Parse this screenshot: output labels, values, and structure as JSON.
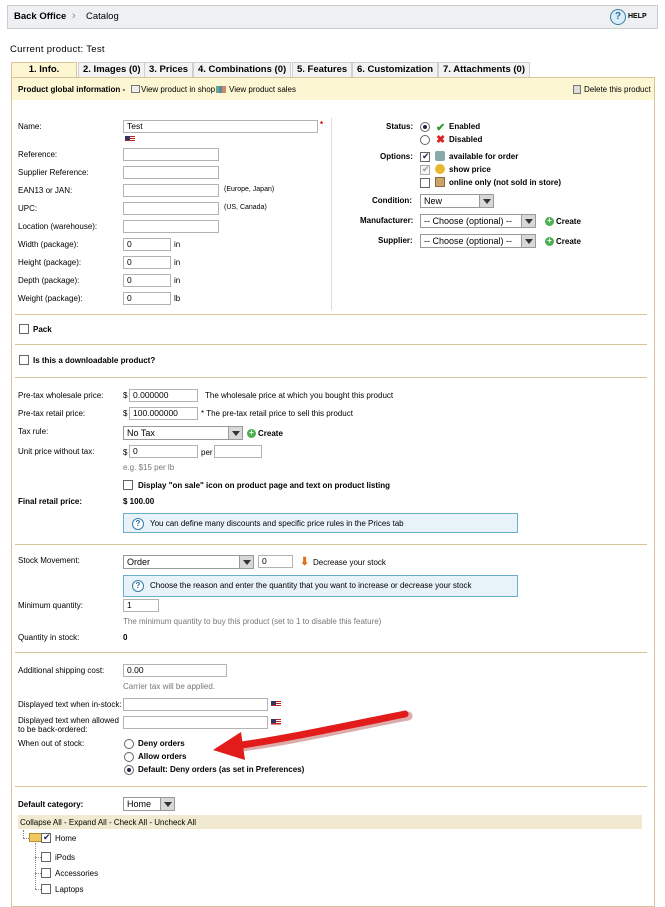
{
  "breadcrumb": {
    "root": "Back Office",
    "sep": "›",
    "current": "Catalog",
    "help": "HELP"
  },
  "current_product": "Current product: Test",
  "tabs": [
    "1. Info.",
    "2. Images (0)",
    "3. Prices",
    "4. Combinations (0)",
    "5. Features",
    "6. Customization",
    "7. Attachments (0)"
  ],
  "header": {
    "title": "Product global information -",
    "view_shop": "View product in shop -",
    "view_sales": "View product sales",
    "delete": "Delete this product"
  },
  "fields": {
    "name_label": "Name:",
    "name_value": "Test",
    "required": "*",
    "reference": "Reference:",
    "supplier_reference": "Supplier Reference:",
    "ean": "EAN13 or JAN:",
    "ean_hint": "(Europe, Japan)",
    "upc": "UPC:",
    "upc_hint": "(US, Canada)",
    "location": "Location (warehouse):",
    "width": "Width (package):",
    "height": "Height (package):",
    "depth": "Depth (package):",
    "weight": "Weight (package):",
    "zero": "0",
    "unit_in": "in",
    "unit_lb": "lb"
  },
  "right": {
    "status": "Status:",
    "enabled": "Enabled",
    "disabled": "Disabled",
    "options": "Options:",
    "available": "available for order",
    "show_price": "show price",
    "online_only": "online only (not sold in store)",
    "condition": "Condition:",
    "condition_value": "New",
    "manufacturer": "Manufacturer:",
    "supplier": "Supplier:",
    "choose": "-- Choose (optional) --",
    "create": "Create"
  },
  "pack": "Pack",
  "downloadable": "Is this a downloadable product?",
  "prices": {
    "wholesale": "Pre-tax wholesale price:",
    "currency": "$",
    "wholesale_value": "0.000000",
    "wholesale_hint": "The wholesale price at which you bought this product",
    "retail": "Pre-tax retail price:",
    "retail_value": "100.000000",
    "retail_hint": "* The pre-tax retail price to sell this product",
    "tax_rule": "Tax rule:",
    "tax_value": "No Tax",
    "create": "Create",
    "unit_price": "Unit price without tax:",
    "unit_value": "0",
    "per": "per",
    "unit_hint": "e.g. $15 per lb",
    "on_sale": "Display \"on sale\" icon on product page and text on product listing",
    "final": "Final retail price:",
    "final_value": "$ 100.00",
    "info": "You can define many discounts and specific price rules in the Prices tab"
  },
  "stock": {
    "movement": "Stock Movement:",
    "movement_value": "Order",
    "qty": "0",
    "decrease": "Decrease your stock",
    "info": "Choose the reason and enter the quantity that you want to increase or decrease your stock",
    "min_qty": "Minimum quantity:",
    "min_value": "1",
    "min_hint": "The minimum quantity to buy this product (set to 1 to disable this feature)",
    "in_stock": "Quantity in stock:",
    "in_stock_value": "0"
  },
  "shipping": {
    "additional": "Additional shipping cost:",
    "additional_value": "0.00",
    "carrier_hint": "Carrier tax will be applied.",
    "in_stock_text": "Displayed text when in-stock:",
    "backorder_text": "Displayed text when allowed to be back-ordered:",
    "out_of_stock": "When out of stock:",
    "deny": "Deny orders",
    "allow": "Allow orders",
    "default": "Default: Deny orders (as set in Preferences)"
  },
  "category": {
    "label": "Default category:",
    "value": "Home",
    "tree_actions": "Collapse All - Expand All - Check All - Uncheck All",
    "tree": [
      "Home",
      "iPods",
      "Accessories",
      "Laptops"
    ]
  },
  "colors": {
    "arrow": "#e21b1b",
    "accent": "#d9c49a",
    "info_border": "#6aaecb"
  }
}
